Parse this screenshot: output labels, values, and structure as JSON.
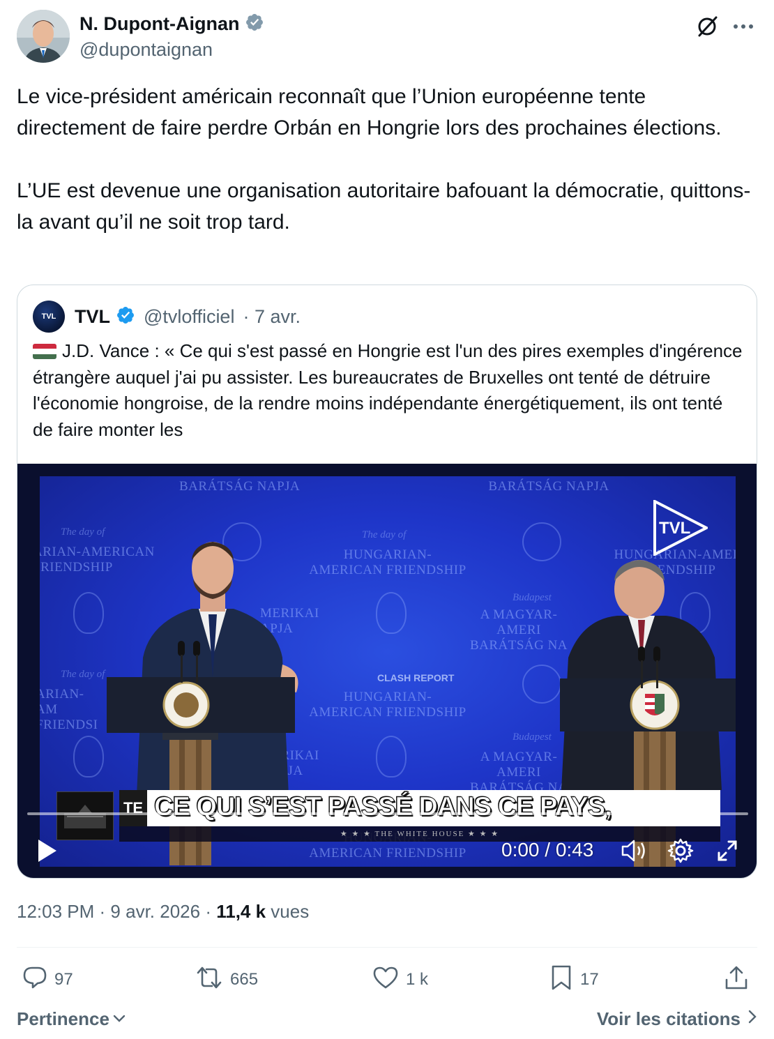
{
  "author": {
    "name": "N. Dupont-Aignan",
    "handle": "@dupontaignan",
    "verified_color": "#829aab"
  },
  "tweet": {
    "paragraph1": "Le vice-président américain reconnaît que l’Union européenne tente directement de faire perdre Orbán en Hongrie lors des prochaines élections.",
    "paragraph2": "L’UE est devenue une organisation autoritaire bafouant la démocratie, quittons-la avant qu’il ne soit trop tard."
  },
  "quoted": {
    "avatar_text": "TVL",
    "name": "TVL",
    "handle": "@tvlofficiel",
    "date": "· 7 avr.",
    "verified_color": "#1d9bf0",
    "text": "J.D. Vance : « Ce qui s'est passé en Hongrie est l'un des pires exemples d'ingérence étrangère auquel j'ai pu assister. Les bureaucrates de Bruxelles ont tenté de détruire l'économie hongroise, de la rendre moins indépendante énergétiquement, ils ont tenté de faire monter les",
    "flag_icon": "hungary-flag-icon"
  },
  "video": {
    "bg": {
      "t1": "BARÁTSÁG NAPJA",
      "t2": "A MAGYAR-AMERIKAI BARÁTSÁG NAPJA",
      "t3": "HUNGARIAN-AMERICAN FRIENDSHIP",
      "t4": "ARIAN-AMERICAN FRIENDSHIP",
      "t5": "HUNGARIAN-AMERICAN FRIENDSHIP",
      "t6": "A MAGYAR-AMERI BARÁTSÁG NA",
      "t7": "HUNGARIAN-AMERICAN FRIENDSHIP",
      "t8": "ARIAN-AM FRIENDSI",
      "t9": "A MAGYAR-AMERI BARÁTSÁG NA",
      "t10": "HUNGARIAN-AMEI FRIENDSHIP",
      "t11": "MERIKAI APJA",
      "t12": "MERIKAI NAPJA",
      "script1": "The day of",
      "script2": "The day of",
      "script3": "Budapest",
      "script4": "Budapest",
      "script5": "The day of"
    },
    "logo": "TVL",
    "watermark": "CLASH REPORT",
    "lower_third_tag": "TE",
    "caption": "CE QUI S’EST PASSÉ DANS CE PAYS,",
    "lower_sub": "★ ★ ★   THE WHITE HOUSE   ★ ★ ★",
    "time": "0:00 / 0:43"
  },
  "meta": {
    "time": "12:03 PM",
    "date": "9 avr. 2026",
    "views_count": "11,4 k",
    "views_label": "vues"
  },
  "actions": {
    "replies": "97",
    "reposts": "665",
    "likes": "1 k",
    "bookmarks": "17"
  },
  "footer": {
    "sort_label": "Pertinence",
    "quotes_label": "Voir les citations"
  }
}
